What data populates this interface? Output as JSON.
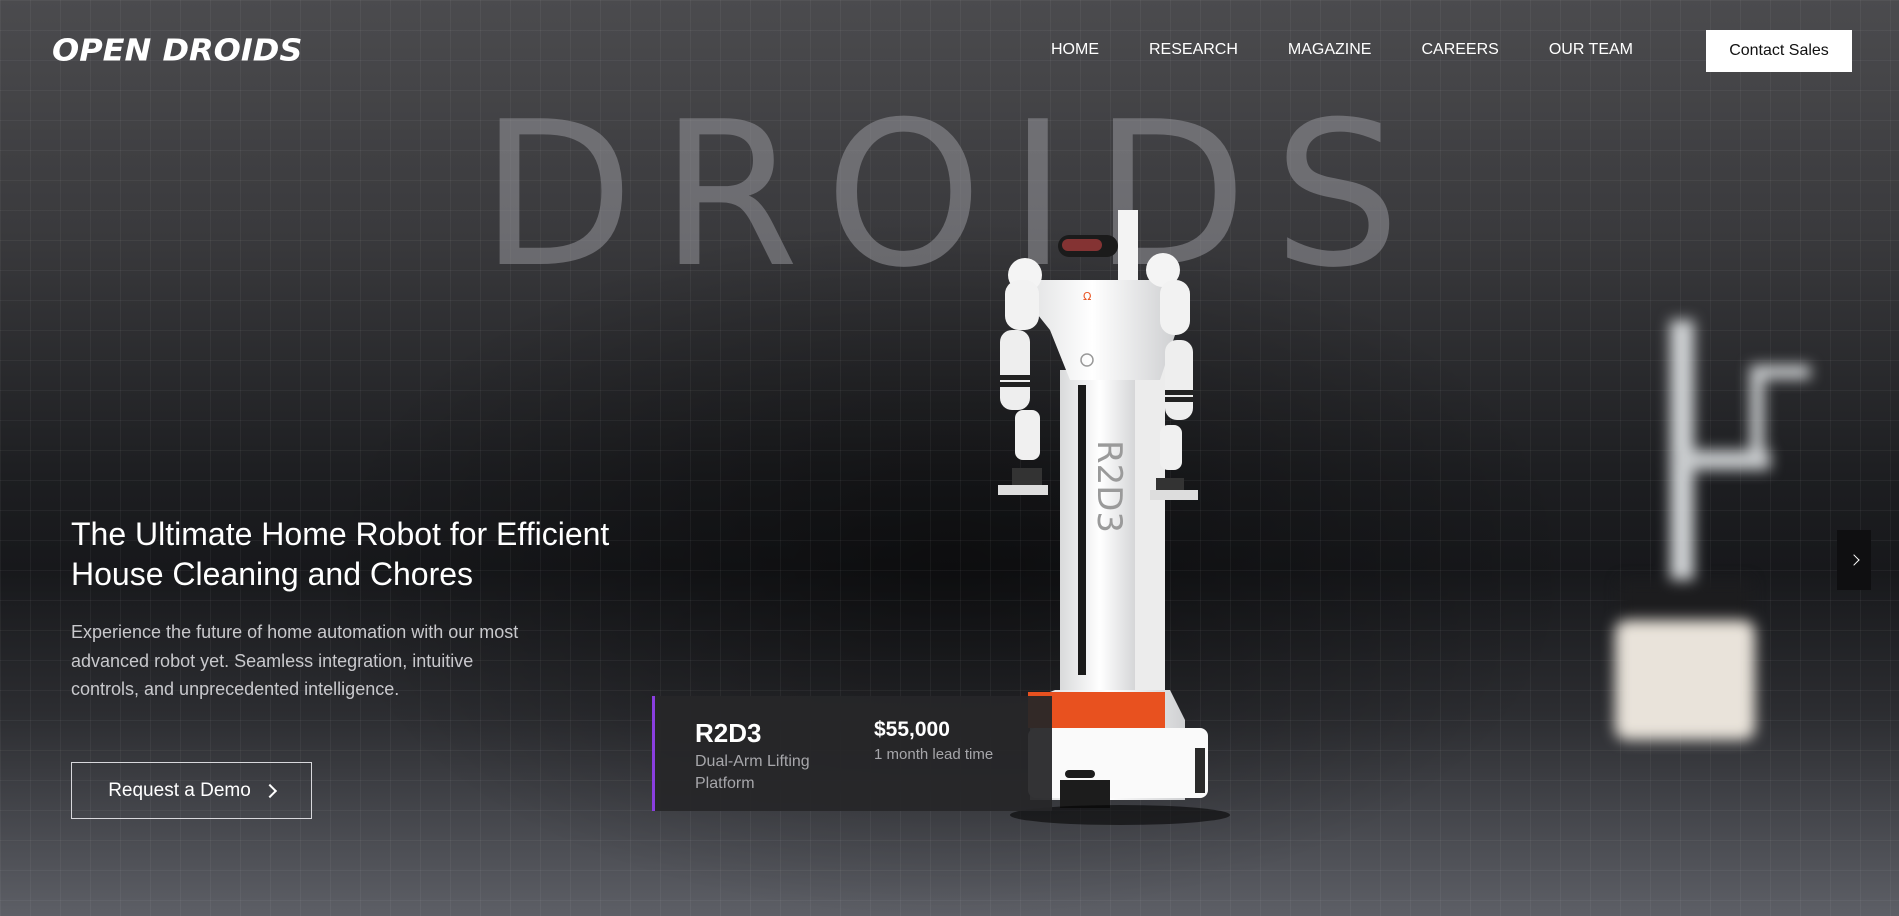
{
  "header": {
    "logo_text": "OPEN DROIDS",
    "nav": [
      "HOME",
      "RESEARCH",
      "MAGAZINE",
      "CAREERS",
      "OUR TEAM"
    ],
    "contact_label": "Contact Sales"
  },
  "background_word": "DROIDS",
  "hero": {
    "title": "The Ultimate Home Robot for Efficient House Cleaning and Chores",
    "description": "Experience the future of home automation with our most advanced robot yet. Seamless integration, intuitive controls, and unprecedented intelligence.",
    "cta_label": "Request a Demo"
  },
  "product": {
    "name": "R2D3",
    "subtitle": "Dual-Arm Lifting Platform",
    "price": "$55,000",
    "lead_time": "1 month lead time",
    "body_label": "R2D3"
  },
  "colors": {
    "accent": "#8a3ee0",
    "robot_orange": "#e8511f"
  },
  "icons": {
    "cta": "chevron-right-icon",
    "next": "chevron-right-icon"
  }
}
